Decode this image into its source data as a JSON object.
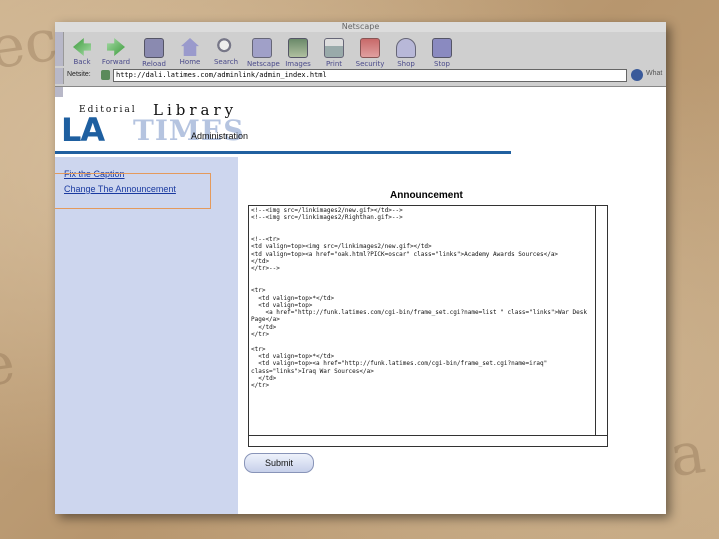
{
  "browser": {
    "title": "Netscape",
    "toolbar": [
      {
        "label": "Back",
        "icon": "back-icon"
      },
      {
        "label": "Forward",
        "icon": "forward-icon"
      },
      {
        "label": "Reload",
        "icon": "reload-icon"
      },
      {
        "label": "Home",
        "icon": "home-icon"
      },
      {
        "label": "Search",
        "icon": "search-icon"
      },
      {
        "label": "Netscape",
        "icon": "netscape-icon"
      },
      {
        "label": "Images",
        "icon": "images-icon"
      },
      {
        "label": "Print",
        "icon": "print-icon"
      },
      {
        "label": "Security",
        "icon": "security-icon"
      },
      {
        "label": "Shop",
        "icon": "shop-icon"
      },
      {
        "label": "Stop",
        "icon": "stop-icon"
      }
    ],
    "location_label": "Netsite:",
    "url": "http://dali.latimes.com/adminlink/admin_index.html",
    "whats_related": "What"
  },
  "page": {
    "logo": {
      "editorial": "Editorial",
      "library": "Library",
      "la": "LA",
      "times": "TIMES",
      "administration": "Administration"
    },
    "sidebar": {
      "links": [
        "Fix the Caption",
        "Change The Announcement"
      ]
    },
    "announcement_title": "Announcement",
    "announcement_text": "<!--<img src=/linkimages2/new.gif></td>-->\n<!--<img src=/linkimages2/Righthan.gif>-->\n\n\n<!--<tr>\n<td valign=top><img src=/linkimages2/new.gif></td>\n<td valign=top><a href=\"oak.html?PICK=oscar\" class=\"links\">Academy Awards Sources</a>\n</td>\n</tr>-->\n\n\n<tr>\n  <td valign=top>*</td>\n  <td valign=top>\n    <a href=\"http://funk.latimes.com/cgi-bin/frame_set.cgi?name=list \" class=\"links\">War Desk Page</a>\n  </td>\n</tr>\n\n<tr>\n  <td valign=top>*</td>\n  <td valign=top><a href=\"http://funk.latimes.com/cgi-bin/frame_set.cgi?name=iraq\" class=\"links\">Iraq War Sources</a>\n  </td>\n</tr>",
    "submit_label": "Submit"
  },
  "colors": {
    "accent_blue": "#2060a0",
    "sidebar_bg": "#cdd6ee",
    "link": "#1a3aa0",
    "highlight_border": "#e49a5c"
  }
}
